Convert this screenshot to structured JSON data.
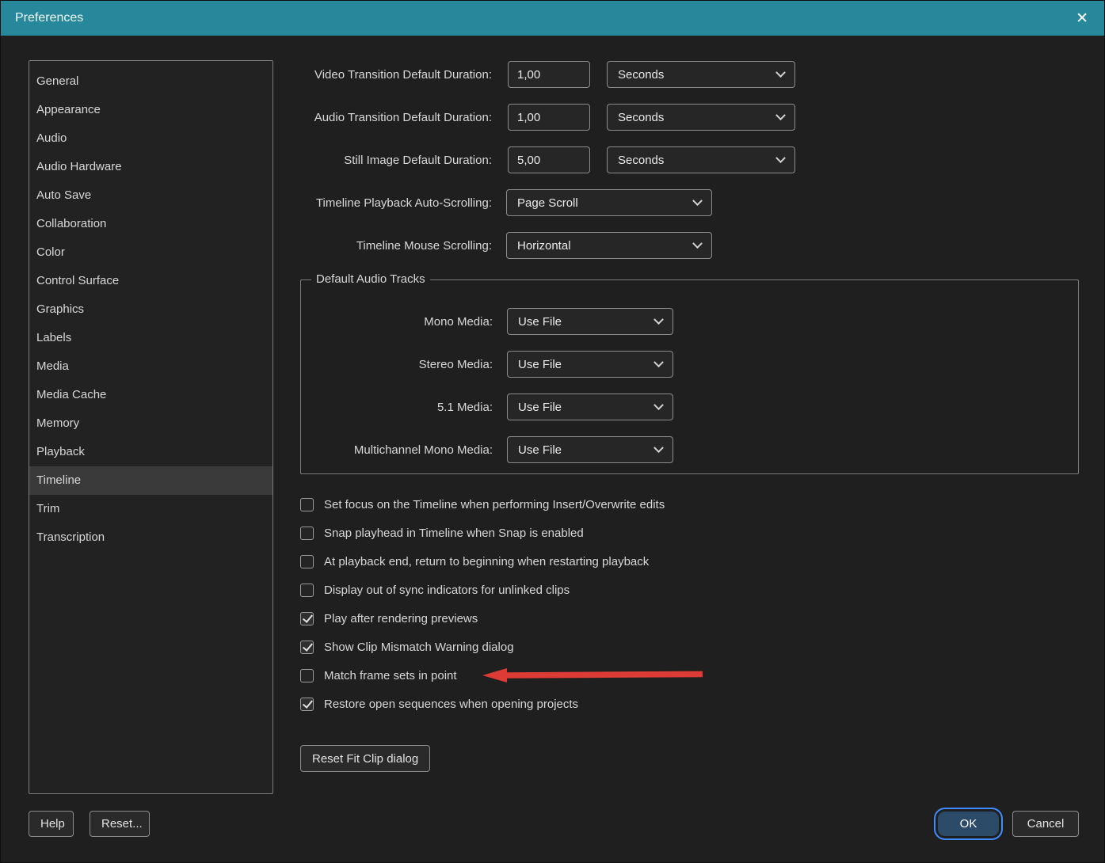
{
  "window": {
    "title": "Preferences"
  },
  "icons": {
    "close": "✕"
  },
  "colors": {
    "titlebar": "#27889b",
    "accent_blue": "#3f8cff",
    "arrow_red": "#dd3b36",
    "background": "#1f1f1f"
  },
  "sidebar": {
    "items": [
      {
        "label": "General",
        "selected": false
      },
      {
        "label": "Appearance",
        "selected": false
      },
      {
        "label": "Audio",
        "selected": false
      },
      {
        "label": "Audio Hardware",
        "selected": false
      },
      {
        "label": "Auto Save",
        "selected": false
      },
      {
        "label": "Collaboration",
        "selected": false
      },
      {
        "label": "Color",
        "selected": false
      },
      {
        "label": "Control Surface",
        "selected": false
      },
      {
        "label": "Graphics",
        "selected": false
      },
      {
        "label": "Labels",
        "selected": false
      },
      {
        "label": "Media",
        "selected": false
      },
      {
        "label": "Media Cache",
        "selected": false
      },
      {
        "label": "Memory",
        "selected": false
      },
      {
        "label": "Playback",
        "selected": false
      },
      {
        "label": "Timeline",
        "selected": true
      },
      {
        "label": "Trim",
        "selected": false
      },
      {
        "label": "Transcription",
        "selected": false
      }
    ]
  },
  "duration_rows": [
    {
      "label": "Video Transition Default Duration:",
      "value": "1,00",
      "unit": "Seconds"
    },
    {
      "label": "Audio Transition Default Duration:",
      "value": "1,00",
      "unit": "Seconds"
    },
    {
      "label": "Still Image Default Duration:",
      "value": "5,00",
      "unit": "Seconds"
    }
  ],
  "scroll_rows": [
    {
      "label": "Timeline Playback Auto-Scrolling:",
      "value": "Page Scroll"
    },
    {
      "label": "Timeline Mouse Scrolling:",
      "value": "Horizontal"
    }
  ],
  "audio_tracks_group": {
    "title": "Default Audio Tracks",
    "rows": [
      {
        "label": "Mono Media:",
        "value": "Use File"
      },
      {
        "label": "Stereo Media:",
        "value": "Use File"
      },
      {
        "label": "5.1 Media:",
        "value": "Use File"
      },
      {
        "label": "Multichannel Mono Media:",
        "value": "Use File"
      }
    ]
  },
  "checkboxes": [
    {
      "label": "Set focus on the Timeline when performing Insert/Overwrite edits",
      "checked": false
    },
    {
      "label": "Snap playhead in Timeline when Snap is enabled",
      "checked": false
    },
    {
      "label": "At playback end, return to beginning when restarting playback",
      "checked": false
    },
    {
      "label": "Display out of sync indicators for unlinked clips",
      "checked": false
    },
    {
      "label": "Play after rendering previews",
      "checked": true
    },
    {
      "label": "Show Clip Mismatch Warning dialog",
      "checked": true
    },
    {
      "label": "Match frame sets in point",
      "checked": false,
      "annotated": true
    },
    {
      "label": "Restore open sequences when opening projects",
      "checked": true
    }
  ],
  "buttons": {
    "reset_fit_clip": "Reset Fit Clip dialog",
    "help": "Help",
    "reset": "Reset...",
    "ok": "OK",
    "cancel": "Cancel"
  }
}
